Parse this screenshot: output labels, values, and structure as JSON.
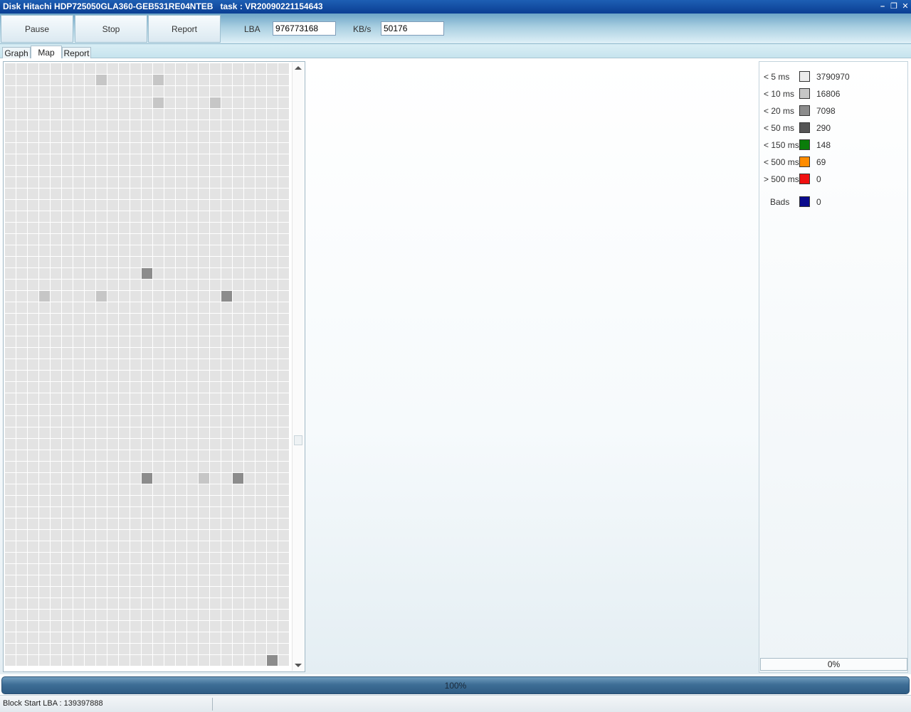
{
  "window": {
    "title": "Disk Hitachi HDP725050GLA360-GEB531RE04NTEB   task : VR20090221154643",
    "minimize_icon": "minimize-icon",
    "restore_icon": "restore-icon",
    "close_icon": "close-icon"
  },
  "toolbar": {
    "pause_label": "Pause",
    "stop_label": "Stop",
    "report_label": "Report",
    "lba_label": "LBA",
    "lba_value": "976773168",
    "kbs_label": "KB/s",
    "kbs_value": "50176"
  },
  "tabs": [
    {
      "label": "Graph",
      "active": false
    },
    {
      "label": "Map",
      "active": true
    },
    {
      "label": "Report",
      "active": false
    }
  ],
  "map": {
    "default_color": "#e3e3e3",
    "highlighted_blocks": [
      {
        "row": 1,
        "col": 8,
        "color": "#c6c6c6"
      },
      {
        "row": 1,
        "col": 13,
        "color": "#c6c6c6"
      },
      {
        "row": 3,
        "col": 13,
        "color": "#c6c6c6"
      },
      {
        "row": 3,
        "col": 18,
        "color": "#c6c6c6"
      },
      {
        "row": 18,
        "col": 12,
        "color": "#8c8c8c"
      },
      {
        "row": 20,
        "col": 3,
        "color": "#c6c6c6"
      },
      {
        "row": 20,
        "col": 8,
        "color": "#c6c6c6"
      },
      {
        "row": 20,
        "col": 19,
        "color": "#8c8c8c"
      },
      {
        "row": 36,
        "col": 12,
        "color": "#8c8c8c"
      },
      {
        "row": 36,
        "col": 17,
        "color": "#c6c6c6"
      },
      {
        "row": 36,
        "col": 20,
        "color": "#8c8c8c"
      },
      {
        "row": 52,
        "col": 23,
        "color": "#8c8c8c"
      }
    ]
  },
  "legend": [
    {
      "label": "< 5 ms",
      "color": "#ececec",
      "value": "3790970"
    },
    {
      "label": "< 10 ms",
      "color": "#c6c6c6",
      "value": "16806"
    },
    {
      "label": "< 20 ms",
      "color": "#8c8c8c",
      "value": "7098"
    },
    {
      "label": "< 50 ms",
      "color": "#555555",
      "value": "290"
    },
    {
      "label": "< 150 ms",
      "color": "#0a7d0a",
      "value": "148"
    },
    {
      "label": "< 500 ms",
      "color": "#ff8c00",
      "value": "69"
    },
    {
      "label": "> 500 ms",
      "color": "#f01010",
      "value": "0"
    },
    {
      "label": "Bads",
      "color": "#0a0a8c",
      "value": "0"
    }
  ],
  "legend_progress": "0%",
  "progress": "100%",
  "status": {
    "text": "Block Start LBA : 139397888"
  }
}
